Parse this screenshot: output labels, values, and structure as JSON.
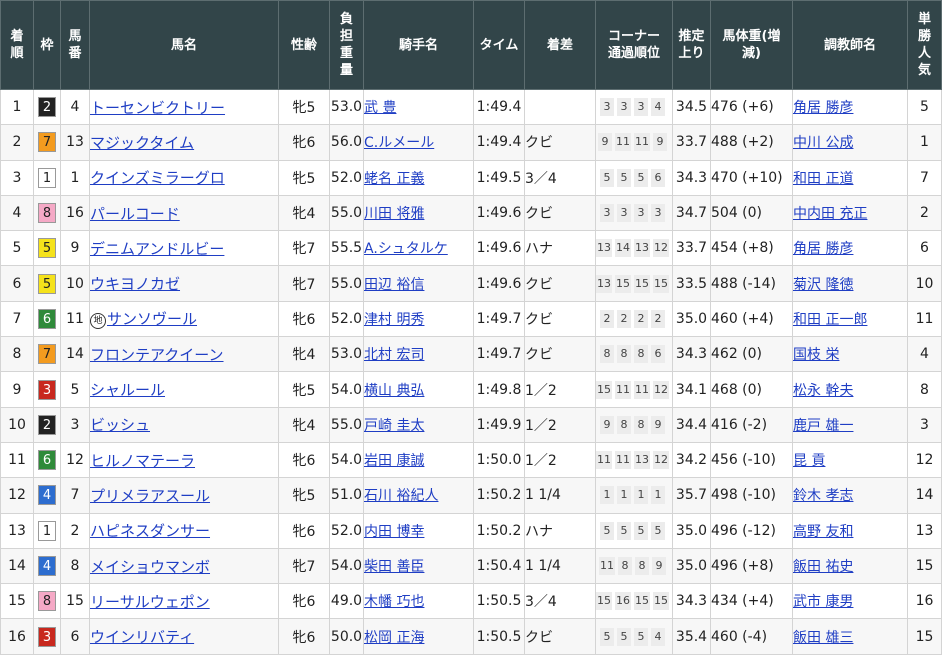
{
  "headers": {
    "rank": "着順",
    "waku": "枠",
    "umaban": "馬番",
    "horse": "馬名",
    "sexage": "性齢",
    "weight": "負担重量",
    "jockey": "騎手名",
    "time": "タイム",
    "margin": "着差",
    "corner": "コーナー通過順位",
    "last3f": "推定上り",
    "bodyweight": "馬体重(増減)",
    "trainer": "調教師名",
    "pop": "単勝人気"
  },
  "colors": {
    "header_bg": "#324549",
    "link": "#1f3ec4",
    "waku1": "#ffffff",
    "waku2": "#222222",
    "waku3": "#c8281e",
    "waku4": "#2d6dcf",
    "waku5": "#f5e21b",
    "waku6": "#2f8a3a",
    "waku7": "#f39b1f",
    "waku8": "#f5a9c6"
  },
  "rows": [
    {
      "rank": "1",
      "waku": "2",
      "umaban": "4",
      "horse": "トーセンビクトリー",
      "chihou": "",
      "sexage": "牝5",
      "weight": "53.0",
      "jockey": "武 豊",
      "time": "1:49.4",
      "margin": "",
      "corner": [
        "3",
        "3",
        "3",
        "4"
      ],
      "last3f": "34.5",
      "bodyweight": "476 (+6)",
      "trainer": "角居 勝彦",
      "pop": "5"
    },
    {
      "rank": "2",
      "waku": "7",
      "umaban": "13",
      "horse": "マジックタイム",
      "chihou": "",
      "sexage": "牝6",
      "weight": "56.0",
      "jockey": "C.ルメール",
      "time": "1:49.4",
      "margin": "クビ",
      "corner": [
        "9",
        "11",
        "11",
        "9"
      ],
      "last3f": "33.7",
      "bodyweight": "488 (+2)",
      "trainer": "中川 公成",
      "pop": "1"
    },
    {
      "rank": "3",
      "waku": "1",
      "umaban": "1",
      "horse": "クインズミラーグロ",
      "chihou": "",
      "sexage": "牝5",
      "weight": "52.0",
      "jockey": "蛯名 正義",
      "time": "1:49.5",
      "margin": "3／4",
      "corner": [
        "5",
        "5",
        "5",
        "6"
      ],
      "last3f": "34.3",
      "bodyweight": "470 (+10)",
      "trainer": "和田 正道",
      "pop": "7"
    },
    {
      "rank": "4",
      "waku": "8",
      "umaban": "16",
      "horse": "パールコード",
      "chihou": "",
      "sexage": "牝4",
      "weight": "55.0",
      "jockey": "川田 将雅",
      "time": "1:49.6",
      "margin": "クビ",
      "corner": [
        "3",
        "3",
        "3",
        "3"
      ],
      "last3f": "34.7",
      "bodyweight": "504 (0)",
      "trainer": "中内田 充正",
      "pop": "2"
    },
    {
      "rank": "5",
      "waku": "5",
      "umaban": "9",
      "horse": "デニムアンドルビー",
      "chihou": "",
      "sexage": "牝7",
      "weight": "55.5",
      "jockey": "A.シュタルケ",
      "time": "1:49.6",
      "margin": "ハナ",
      "corner": [
        "13",
        "14",
        "13",
        "12"
      ],
      "last3f": "33.7",
      "bodyweight": "454 (+8)",
      "trainer": "角居 勝彦",
      "pop": "6"
    },
    {
      "rank": "6",
      "waku": "5",
      "umaban": "10",
      "horse": "ウキヨノカゼ",
      "chihou": "",
      "sexage": "牝7",
      "weight": "55.0",
      "jockey": "田辺 裕信",
      "time": "1:49.6",
      "margin": "クビ",
      "corner": [
        "13",
        "15",
        "15",
        "15"
      ],
      "last3f": "33.5",
      "bodyweight": "488 (-14)",
      "trainer": "菊沢 隆徳",
      "pop": "10"
    },
    {
      "rank": "7",
      "waku": "6",
      "umaban": "11",
      "horse": "サンソヴール",
      "chihou": "地",
      "sexage": "牝6",
      "weight": "52.0",
      "jockey": "津村 明秀",
      "time": "1:49.7",
      "margin": "クビ",
      "corner": [
        "2",
        "2",
        "2",
        "2"
      ],
      "last3f": "35.0",
      "bodyweight": "460 (+4)",
      "trainer": "和田 正一郎",
      "pop": "11"
    },
    {
      "rank": "8",
      "waku": "7",
      "umaban": "14",
      "horse": "フロンテアクイーン",
      "chihou": "",
      "sexage": "牝4",
      "weight": "53.0",
      "jockey": "北村 宏司",
      "time": "1:49.7",
      "margin": "クビ",
      "corner": [
        "8",
        "8",
        "8",
        "6"
      ],
      "last3f": "34.3",
      "bodyweight": "462 (0)",
      "trainer": "国枝 栄",
      "pop": "4"
    },
    {
      "rank": "9",
      "waku": "3",
      "umaban": "5",
      "horse": "シャルール",
      "chihou": "",
      "sexage": "牝5",
      "weight": "54.0",
      "jockey": "横山 典弘",
      "time": "1:49.8",
      "margin": "1／2",
      "corner": [
        "15",
        "11",
        "11",
        "12"
      ],
      "last3f": "34.1",
      "bodyweight": "468 (0)",
      "trainer": "松永 幹夫",
      "pop": "8"
    },
    {
      "rank": "10",
      "waku": "2",
      "umaban": "3",
      "horse": "ビッシュ",
      "chihou": "",
      "sexage": "牝4",
      "weight": "55.0",
      "jockey": "戸崎 圭太",
      "time": "1:49.9",
      "margin": "1／2",
      "corner": [
        "9",
        "8",
        "8",
        "9"
      ],
      "last3f": "34.4",
      "bodyweight": "416 (-2)",
      "trainer": "鹿戸 雄一",
      "pop": "3"
    },
    {
      "rank": "11",
      "waku": "6",
      "umaban": "12",
      "horse": "ヒルノマテーラ",
      "chihou": "",
      "sexage": "牝6",
      "weight": "54.0",
      "jockey": "岩田 康誠",
      "time": "1:50.0",
      "margin": "1／2",
      "corner": [
        "11",
        "11",
        "13",
        "12"
      ],
      "last3f": "34.2",
      "bodyweight": "456 (-10)",
      "trainer": "昆 貢",
      "pop": "12"
    },
    {
      "rank": "12",
      "waku": "4",
      "umaban": "7",
      "horse": "プリメラアスール",
      "chihou": "",
      "sexage": "牝5",
      "weight": "51.0",
      "jockey": "石川 裕紀人",
      "time": "1:50.2",
      "margin": "1 1/4",
      "corner": [
        "1",
        "1",
        "1",
        "1"
      ],
      "last3f": "35.7",
      "bodyweight": "498 (-10)",
      "trainer": "鈴木 孝志",
      "pop": "14"
    },
    {
      "rank": "13",
      "waku": "1",
      "umaban": "2",
      "horse": "ハピネスダンサー",
      "chihou": "",
      "sexage": "牝6",
      "weight": "52.0",
      "jockey": "内田 博幸",
      "time": "1:50.2",
      "margin": "ハナ",
      "corner": [
        "5",
        "5",
        "5",
        "5"
      ],
      "last3f": "35.0",
      "bodyweight": "496 (-12)",
      "trainer": "高野 友和",
      "pop": "13"
    },
    {
      "rank": "14",
      "waku": "4",
      "umaban": "8",
      "horse": "メイショウマンボ",
      "chihou": "",
      "sexage": "牝7",
      "weight": "54.0",
      "jockey": "柴田 善臣",
      "time": "1:50.4",
      "margin": "1 1/4",
      "corner": [
        "11",
        "8",
        "8",
        "9"
      ],
      "last3f": "35.0",
      "bodyweight": "496 (+8)",
      "trainer": "飯田 祐史",
      "pop": "15"
    },
    {
      "rank": "15",
      "waku": "8",
      "umaban": "15",
      "horse": "リーサルウェポン",
      "chihou": "",
      "sexage": "牝6",
      "weight": "49.0",
      "jockey": "木幡 巧也",
      "time": "1:50.5",
      "margin": "3／4",
      "corner": [
        "15",
        "16",
        "15",
        "15"
      ],
      "last3f": "34.3",
      "bodyweight": "434 (+4)",
      "trainer": "武市 康男",
      "pop": "16"
    },
    {
      "rank": "16",
      "waku": "3",
      "umaban": "6",
      "horse": "ウインリバティ",
      "chihou": "",
      "sexage": "牝6",
      "weight": "50.0",
      "jockey": "松岡 正海",
      "time": "1:50.5",
      "margin": "クビ",
      "corner": [
        "5",
        "5",
        "5",
        "4"
      ],
      "last3f": "35.4",
      "bodyweight": "460 (-4)",
      "trainer": "飯田 雄三",
      "pop": "15"
    }
  ]
}
